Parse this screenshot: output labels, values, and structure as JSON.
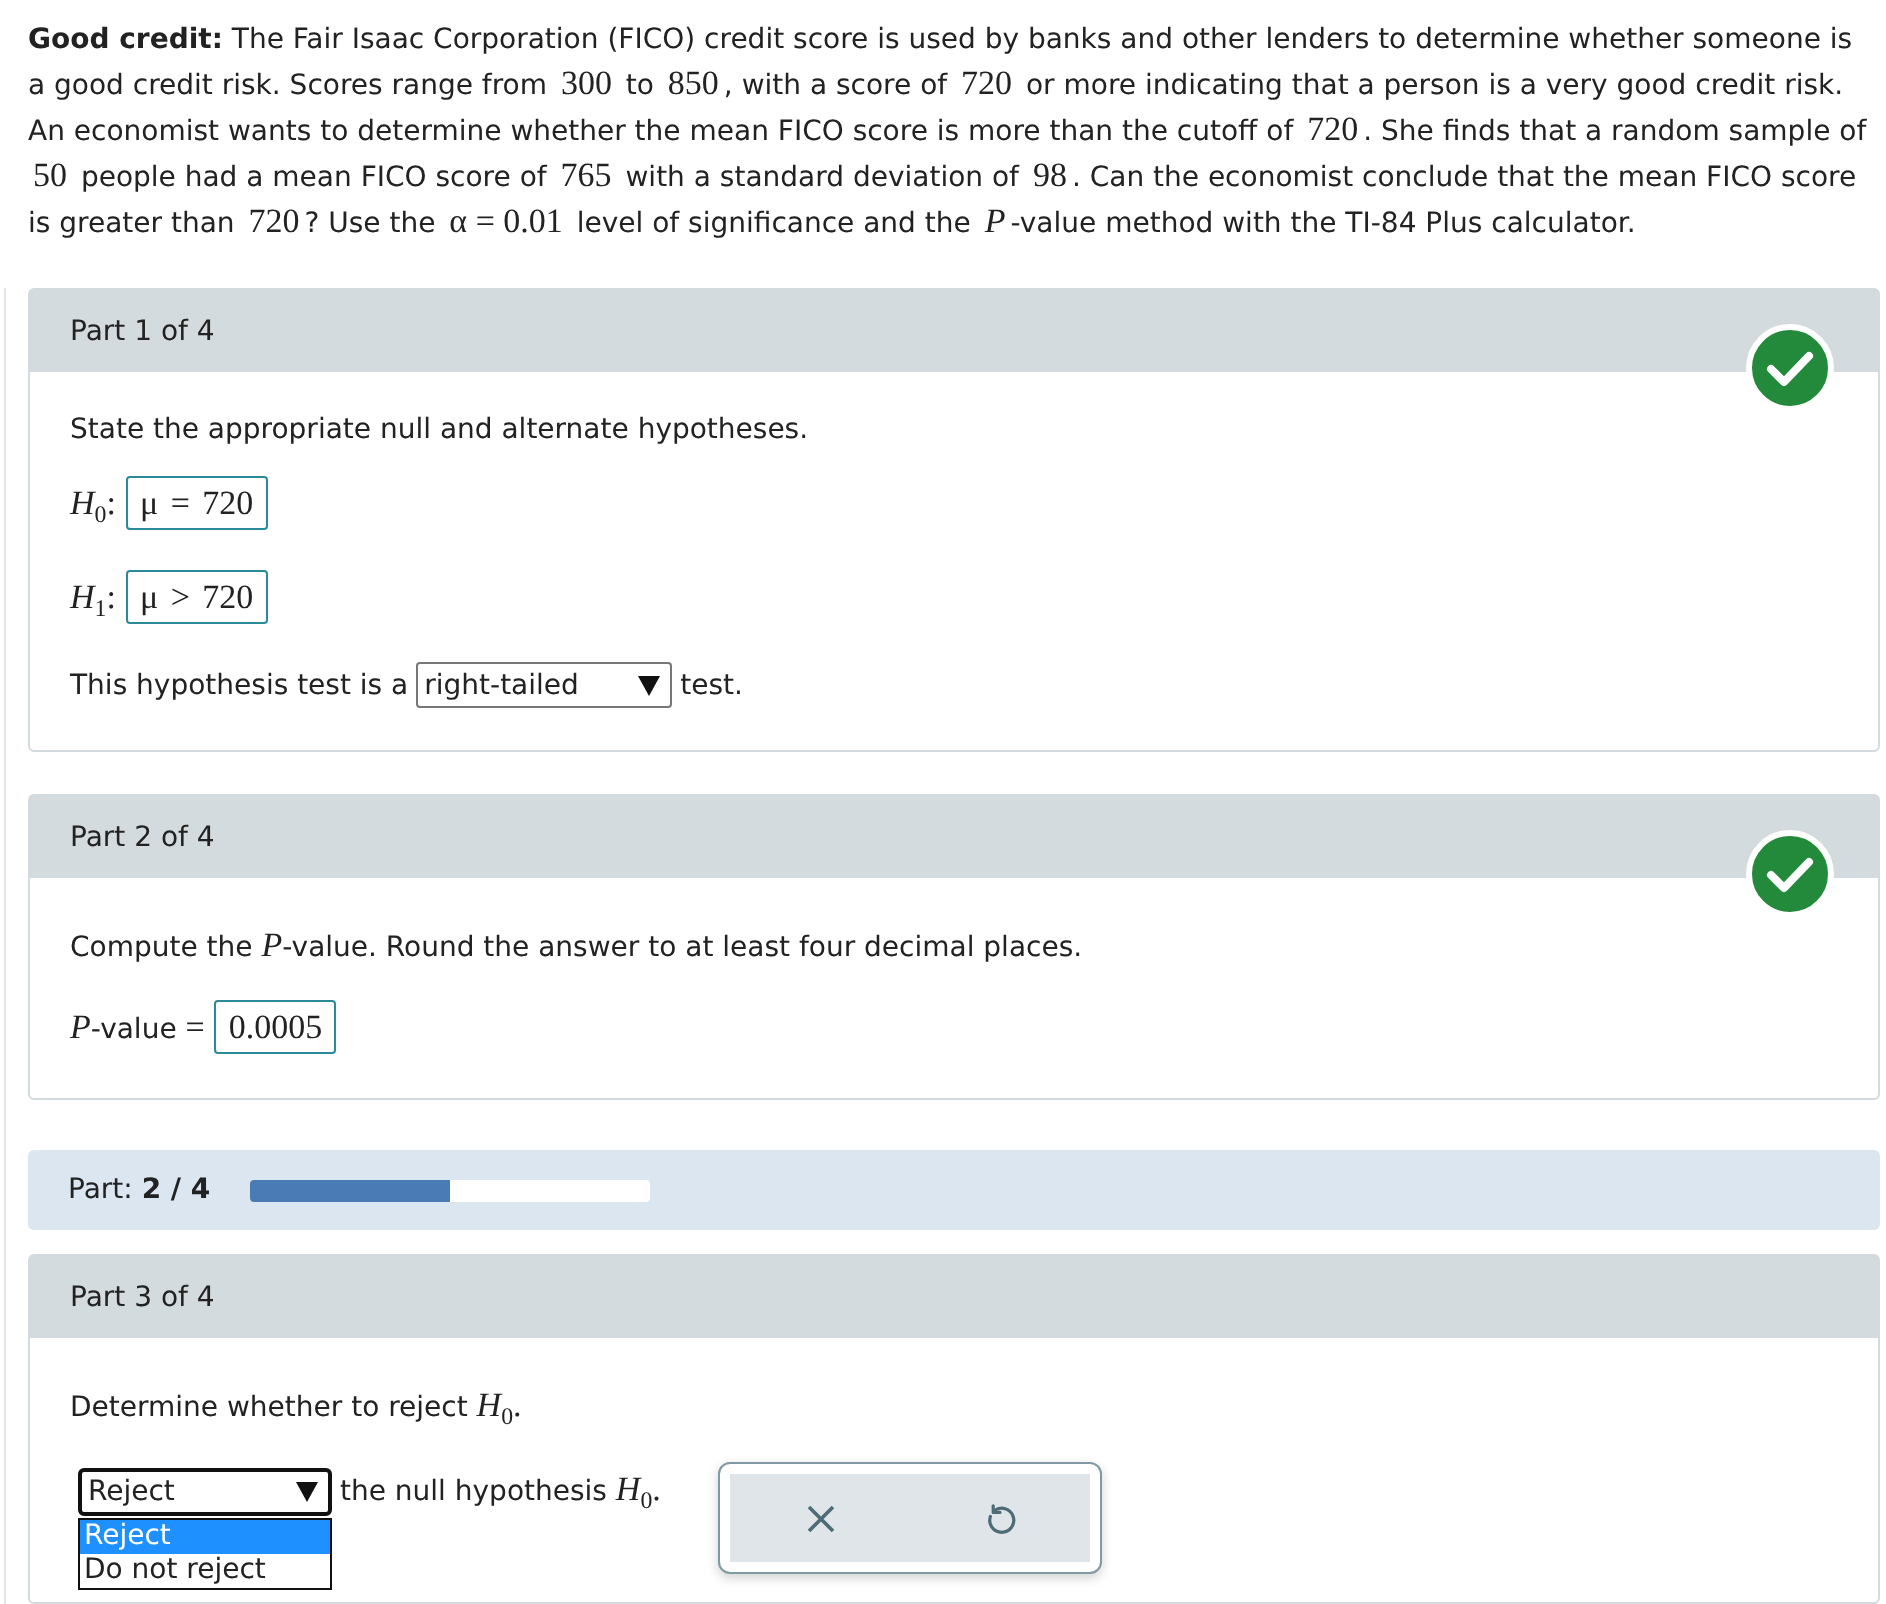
{
  "intro": [
    {
      "kind": "text",
      "text": "**Good credit:** The Fair Isaac Corporation (FICO) credit score is used by banks and other lenders to determine whether someone is a good credit risk. Scores range from "
    },
    {
      "kind": "math",
      "text": "300"
    },
    {
      "kind": "text",
      "text": " to "
    },
    {
      "kind": "math",
      "text": "850"
    },
    {
      "kind": "text",
      "text": ", with a score of "
    },
    {
      "kind": "math",
      "text": "720"
    },
    {
      "kind": "text",
      "text": " or more indicating that a person is a very good credit risk. An economist wants to determine whether the mean FICO score is more than the cutoff of "
    },
    {
      "kind": "math",
      "text": "720"
    },
    {
      "kind": "text",
      "text": ". She finds that a random sample of "
    },
    {
      "kind": "math",
      "text": "50"
    },
    {
      "kind": "text",
      "text": " people had a mean FICO score of "
    },
    {
      "kind": "math",
      "text": "765"
    },
    {
      "kind": "text",
      "text": " with a standard deviation of "
    },
    {
      "kind": "math",
      "text": "98"
    },
    {
      "kind": "text",
      "text": ". Can the economist conclude that the mean FICO score is greater than "
    },
    {
      "kind": "math",
      "text": "720"
    },
    {
      "kind": "text",
      "text": "? Use the "
    },
    {
      "kind": "math",
      "text": "α = 0.01"
    },
    {
      "kind": "text",
      "text": " level of significance and the "
    },
    {
      "kind": "math",
      "text": "*P*"
    },
    {
      "kind": "text",
      "text": "-value method with the TI-84 Plus calculator."
    }
  ],
  "sections": [
    {
      "kind": "part",
      "header": "Part 1 of 4",
      "correct": true,
      "rows": [
        {
          "kind": "prompt",
          "runs": [
            {
              "kind": "text",
              "text": "State the appropriate null and alternate hypotheses."
            }
          ]
        },
        {
          "kind": "answer",
          "label": [
            {
              "kind": "math",
              "text": "*H*$_{0}$:"
            }
          ],
          "value": "μ = 720"
        },
        {
          "kind": "answer",
          "label": [
            {
              "kind": "math",
              "text": "*H*$_{1}$:"
            }
          ],
          "value": "μ > 720"
        },
        {
          "kind": "select_line",
          "before": [
            {
              "kind": "text",
              "text": "This hypothesis test is a"
            }
          ],
          "value": "right-tailed",
          "after": [
            {
              "kind": "text",
              "text": "test."
            }
          ],
          "open": false,
          "tools": false
        }
      ]
    },
    {
      "kind": "part",
      "header": "Part 2 of 4",
      "correct": true,
      "rows": [
        {
          "kind": "prompt",
          "runs": [
            {
              "kind": "text",
              "text": "Compute the "
            },
            {
              "kind": "math",
              "text": "*P*"
            },
            {
              "kind": "text",
              "text": "-value. Round the answer to at least four decimal places."
            }
          ]
        },
        {
          "kind": "answer",
          "label": [
            {
              "kind": "math",
              "text": "*P*"
            },
            {
              "kind": "text",
              "text": "-value "
            },
            {
              "kind": "math",
              "text": "="
            }
          ],
          "value": "0.0005"
        }
      ]
    },
    {
      "kind": "progress",
      "text": "Part: **2 / 4**",
      "level": 0.5
    },
    {
      "kind": "part",
      "header": "Part 3 of 4",
      "correct": false,
      "rows": [
        {
          "kind": "prompt",
          "runs": [
            {
              "kind": "text",
              "text": "Determine whether to reject "
            },
            {
              "kind": "math",
              "text": "*H*$_{0}$."
            }
          ]
        },
        {
          "kind": "select_line",
          "value": "Reject",
          "after": [
            {
              "kind": "text",
              "text": "the null hypothesis "
            },
            {
              "kind": "math",
              "text": "*H*$_{0}$."
            }
          ],
          "open": true,
          "options": [
            {
              "label": "Reject",
              "selected": true
            },
            {
              "label": "Do not reject",
              "selected": false
            }
          ],
          "tools": true
        }
      ]
    }
  ]
}
